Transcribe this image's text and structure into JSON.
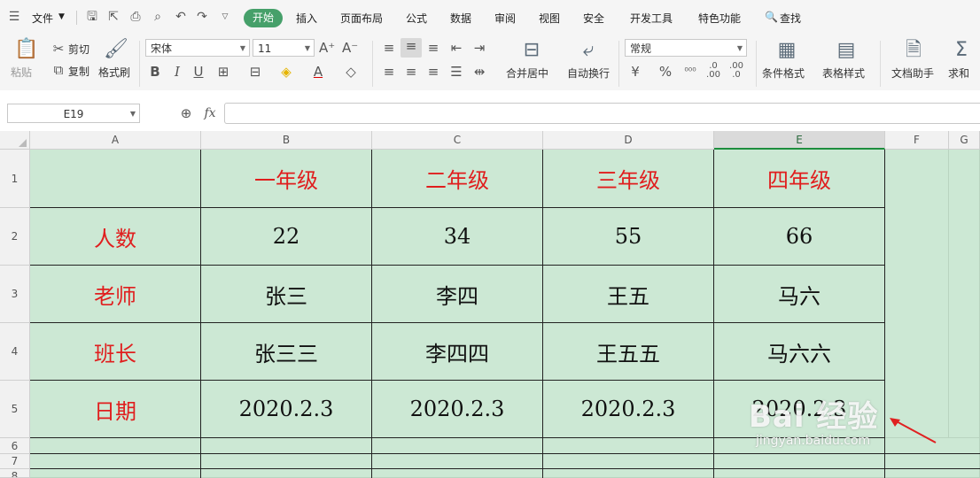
{
  "menubar": {
    "file_label": "文件",
    "tabs": [
      "开始",
      "插入",
      "页面布局",
      "公式",
      "数据",
      "审阅",
      "视图",
      "安全",
      "开发工具",
      "特色功能"
    ],
    "search_label": "查找"
  },
  "ribbon": {
    "paste": "粘贴",
    "cut": "剪切",
    "copy": "复制",
    "format_painter": "格式刷",
    "font_name": "宋体",
    "font_size": "11",
    "grow_font": "A⁺",
    "shrink_font": "A⁻",
    "bold": "B",
    "italic": "I",
    "underline": "U",
    "merge_center": "合并居中",
    "wrap_text": "自动换行",
    "number_format": "常规",
    "percent": "%",
    "conditional_format": "条件格式",
    "table_style": "表格样式",
    "doc_helper": "文档助手",
    "sum": "求和"
  },
  "formula_bar": {
    "name_box": "E19",
    "fx": "fx",
    "content": ""
  },
  "grid": {
    "columns": [
      "A",
      "B",
      "C",
      "D",
      "E",
      "F",
      "G"
    ],
    "selected_column": "E",
    "rows": [
      "1",
      "2",
      "3",
      "4",
      "5",
      "6",
      "7",
      "8"
    ],
    "cells": [
      [
        "",
        "一年级",
        "二年级",
        "三年级",
        "四年级"
      ],
      [
        "人数",
        "22",
        "34",
        "55",
        "66"
      ],
      [
        "老师",
        "张三",
        "李四",
        "王五",
        "马六"
      ],
      [
        "班长",
        "张三三",
        "李四四",
        "王五五",
        "马六六"
      ],
      [
        "日期",
        "2020.2.3",
        "2020.2.3",
        "2020.2.3",
        "2020.2.3"
      ]
    ]
  },
  "watermark": {
    "brand": "Bai 经验",
    "url": "jingyan.baidu.com"
  },
  "colors": {
    "cell_fill": "#cce8d4",
    "header_text_red": "#e01e1e",
    "active_tab": "#46a06a"
  }
}
